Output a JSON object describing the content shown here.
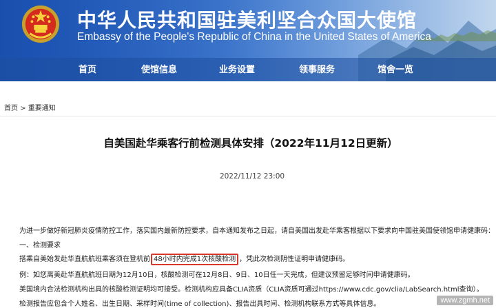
{
  "header": {
    "title_cn": "中华人民共和国驻美利坚合众国大使馆",
    "title_en": "Embassy of the People's Republic of China in the United States of America",
    "emblem_icon": "national-emblem-icon"
  },
  "nav": {
    "items": [
      {
        "label": "首页"
      },
      {
        "label": "使馆信息"
      },
      {
        "label": "业务设置"
      },
      {
        "label": "领事服务"
      },
      {
        "label": "馆舍一览"
      }
    ]
  },
  "breadcrumb": {
    "home": "首页",
    "separator": ">",
    "current": "重要通知"
  },
  "article": {
    "title": "自美国赴华乘客行前检测具体安排（2022年11月12日更新）",
    "date": "2022/11/12 23:00",
    "p1": "为进一步做好新冠肺炎疫情防控工作，落实国内最新防控要求，自本通知发布之日起，请自美国出发赴华乘客根据以下要求向中国驻美国使领馆申请健康码：",
    "p2": "一、检测要求",
    "p3_before": "搭乘自美始发赴华直航航班乘客须在登机前",
    "p3_highlight": "48小时内完成1次核酸检测",
    "p3_after": "，凭此次检测阴性证明申请健康码。",
    "p4": "例：如您离美赴华直航航班日期为12月10日，核酸检测可在12月8日、9日、10日任一天完成，但建议预留足够时间申请健康码。",
    "p5": "美国境内合法检测机构出具的核酸检测证明均可接受。检测机构应具备CLIA资质（CLIA资质可通过https://www.cdc.gov/clia/LabSearch.html查询）。",
    "p6": "检测报告应包含个人姓名、出生日期、采样时间(time of collection)、报告出具时间、检测机构联系方式等具体信息。"
  },
  "watermark": "www.zgmh.net",
  "colors": {
    "banner_blue": "#1a4fae",
    "highlight_red": "#d8382b"
  }
}
